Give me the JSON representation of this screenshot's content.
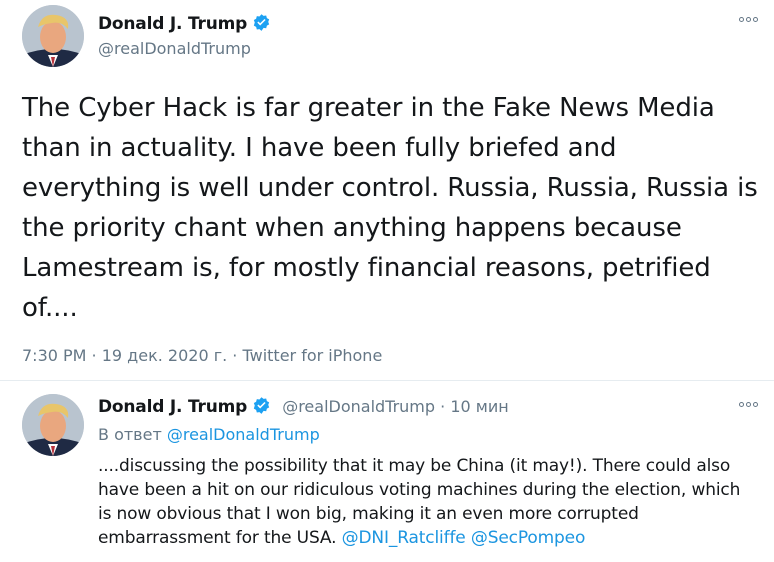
{
  "main_tweet": {
    "author_name": "Donald J. Trump",
    "author_handle": "@realDonaldTrump",
    "text_lines": [
      "The Cyber Hack is far greater in the Fake News Media",
      "than in actuality. I have been fully briefed and",
      "everything is well under control. Russia, Russia, Russia is",
      "the priority chant when anything happens because",
      "Lamestream is, for mostly financial reasons, petrified",
      "of...."
    ],
    "time": "7:30 PM",
    "separator": " · ",
    "date": "19 дек. 2020 г.",
    "source": "Twitter for iPhone"
  },
  "reply_tweet": {
    "author_name": "Donald J. Trump",
    "author_handle": "@realDonaldTrump",
    "separator": " · ",
    "time_ago": "10 мин",
    "reply_prefix": "В ответ ",
    "reply_handle": "@realDonaldTrump",
    "text_lines": [
      "....discussing the possibility that it may be China (it may!). There could also",
      "have been a hit on our ridiculous voting machines during the election, which",
      "is now obvious that I won big, making it an even more corrupted",
      "embarrassment for the USA. "
    ],
    "mention_1": "@DNI_Ratcliffe",
    "mention_2": "@SecPompeo"
  },
  "colors": {
    "text": "#14171a",
    "muted": "#657786",
    "link": "#1b95e0",
    "verified": "#1da1f2",
    "divider": "#e6ecf0"
  },
  "icons": [
    "verified-badge-icon",
    "more-options-icon",
    "avatar"
  ]
}
